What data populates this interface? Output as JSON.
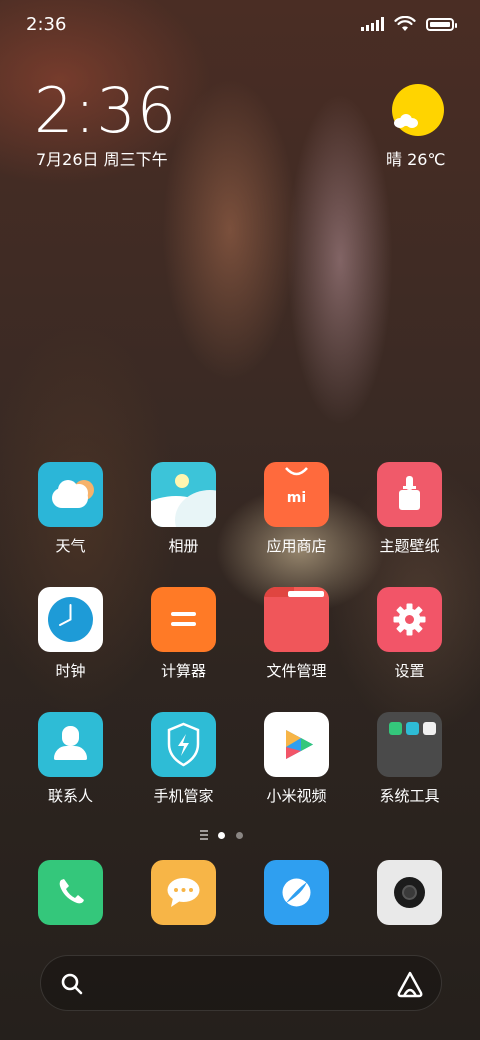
{
  "status_bar": {
    "time": "2:36"
  },
  "lock_widget": {
    "clock": "2:36",
    "date": "7月26日 周三下午",
    "weather": "晴 26℃"
  },
  "apps": [
    {
      "label": "天气",
      "color": "#2bb6d8",
      "icon": "weather-icon"
    },
    {
      "label": "相册",
      "color": "#3cc4d9",
      "icon": "gallery-icon"
    },
    {
      "label": "应用商店",
      "color": "#ff6a3d",
      "icon": "app-store-icon"
    },
    {
      "label": "主题壁纸",
      "color": "#f05a6a",
      "icon": "themes-icon"
    },
    {
      "label": "时钟",
      "color": "#ffffff",
      "icon": "clock-icon"
    },
    {
      "label": "计算器",
      "color": "#ff7a26",
      "icon": "calculator-icon"
    },
    {
      "label": "文件管理",
      "color": "#f45b55",
      "icon": "folder-icon"
    },
    {
      "label": "设置",
      "color": "#f25568",
      "icon": "settings-icon"
    },
    {
      "label": "联系人",
      "color": "#2ebcd6",
      "icon": "contacts-icon"
    },
    {
      "label": "手机管家",
      "color": "#2ebcd6",
      "icon": "security-icon"
    },
    {
      "label": "小米视频",
      "color": "#ffffff",
      "icon": "video-icon"
    },
    {
      "label": "系统工具",
      "color": "#4a4a4a",
      "icon": "tools-folder-icon"
    }
  ],
  "dock": [
    {
      "name": "phone",
      "color": "#34c77b",
      "icon": "phone-icon"
    },
    {
      "name": "messages",
      "color": "#f7b547",
      "icon": "messages-icon"
    },
    {
      "name": "browser",
      "color": "#2f9ff0",
      "icon": "browser-icon"
    },
    {
      "name": "camera",
      "color": "#e9e9e9",
      "icon": "camera-icon"
    }
  ],
  "search": {
    "icon": "search-icon",
    "assistant_icon": "assistant-icon"
  },
  "pagination": {
    "pages": 2,
    "current": 1
  }
}
